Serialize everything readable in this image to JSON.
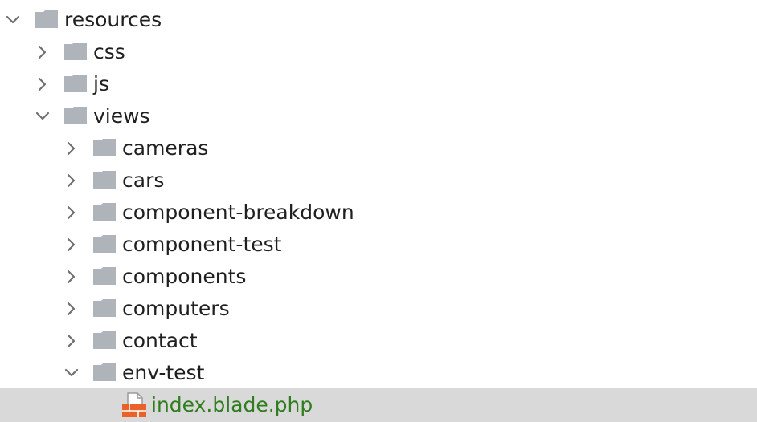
{
  "tree": {
    "resources": {
      "label": "resources",
      "state": "expanded",
      "icon": "folder-icon"
    },
    "css": {
      "label": "css",
      "state": "collapsed",
      "icon": "folder-icon"
    },
    "js": {
      "label": "js",
      "state": "collapsed",
      "icon": "folder-icon"
    },
    "views": {
      "label": "views",
      "state": "expanded",
      "icon": "folder-icon"
    },
    "cameras": {
      "label": "cameras",
      "state": "collapsed",
      "icon": "folder-icon"
    },
    "cars": {
      "label": "cars",
      "state": "collapsed",
      "icon": "folder-icon"
    },
    "component_breakdown": {
      "label": "component-breakdown",
      "state": "collapsed",
      "icon": "folder-icon"
    },
    "component_test": {
      "label": "component-test",
      "state": "collapsed",
      "icon": "folder-icon"
    },
    "components": {
      "label": "components",
      "state": "collapsed",
      "icon": "folder-icon"
    },
    "computers": {
      "label": "computers",
      "state": "collapsed",
      "icon": "folder-icon"
    },
    "contact": {
      "label": "contact",
      "state": "collapsed",
      "icon": "folder-icon"
    },
    "env_test": {
      "label": "env-test",
      "state": "expanded",
      "icon": "folder-icon"
    },
    "index_blade": {
      "label": "index.blade.php",
      "selected": true,
      "icon": "blade-file-icon"
    }
  },
  "colors": {
    "folder": "#afb4ba",
    "chevron": "#707070",
    "selected_row": "#d9d9d9",
    "file_label": "#2f7d1f",
    "blade_icon": "#e8622a"
  }
}
